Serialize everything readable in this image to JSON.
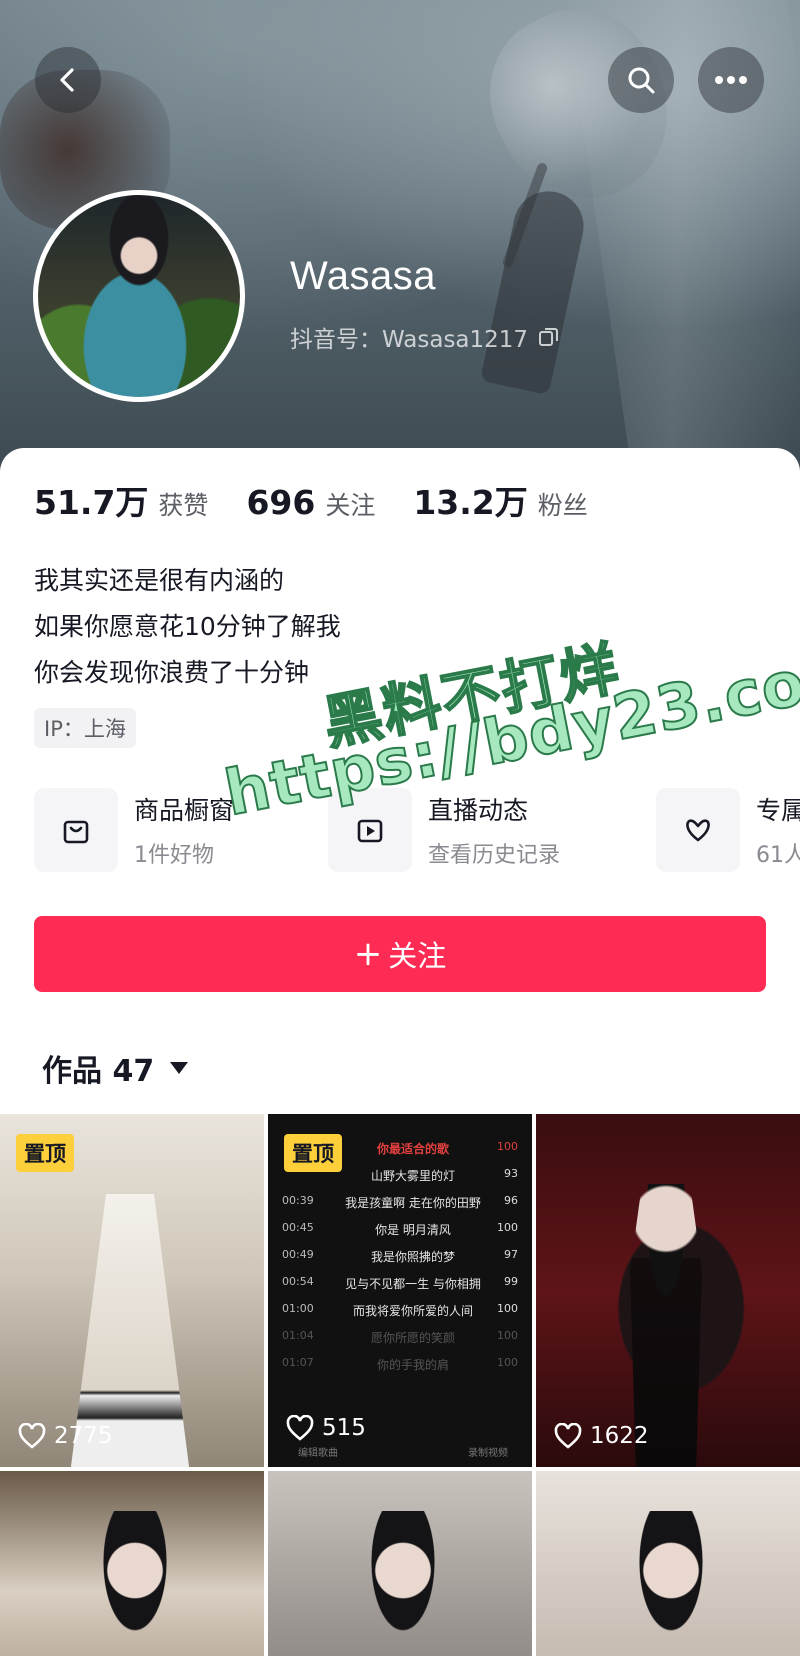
{
  "header": {
    "username": "Wasasa",
    "douyin_id": "抖音号：Wasasa1217",
    "icons": {
      "back": "back-arrow-icon",
      "search": "search-icon",
      "more": "more-dots-icon",
      "copy": "copy-icon"
    }
  },
  "stats": [
    {
      "num": "51.7万",
      "label": "获赞"
    },
    {
      "num": "696",
      "label": "关注"
    },
    {
      "num": "13.2万",
      "label": "粉丝"
    }
  ],
  "bio": {
    "line1": "我其实还是很有内涵的",
    "line2": "如果你愿意花10分钟了解我",
    "line3": "你会发现你浪费了十分钟"
  },
  "ip": "IP：上海",
  "features": [
    {
      "title": "商品橱窗",
      "sub": "1件好物",
      "icon": "bag-icon"
    },
    {
      "title": "直播动态",
      "sub": "查看历史记录",
      "icon": "live-icon"
    },
    {
      "title": "专属",
      "sub": "61人",
      "icon": "heart-v-icon"
    }
  ],
  "follow_button": {
    "plus": "+",
    "label": "关注"
  },
  "works_tab": {
    "label": "作品 47"
  },
  "watermark": {
    "line1": "黑料不打烊",
    "line2": "https://bdy23.co"
  },
  "videos": [
    {
      "pinned": "置顶",
      "likes": "2775"
    },
    {
      "pinned": "置顶",
      "likes": "515"
    },
    {
      "likes": "1622"
    }
  ],
  "lyric_card": {
    "header": {
      "title": "你最适合的歌",
      "score": "100"
    },
    "rows": [
      {
        "time": "",
        "text": "山野大雾里的灯",
        "score": "93"
      },
      {
        "time": "00:39",
        "text": "我是孩童啊 走在你的田野",
        "score": "96"
      },
      {
        "time": "00:45",
        "text": "你是 明月清风",
        "score": "100"
      },
      {
        "time": "00:49",
        "text": "我是你照拂的梦",
        "score": "97"
      },
      {
        "time": "00:54",
        "text": "见与不见都一生 与你相拥",
        "score": "99"
      },
      {
        "time": "01:00",
        "text": "而我将爱你所爱的人间",
        "score": "100"
      },
      {
        "time": "01:04",
        "text": "愿你所愿的笑颜",
        "score": "100"
      },
      {
        "time": "01:07",
        "text": "你的手我的肩",
        "score": "100"
      }
    ],
    "footer": {
      "left": "编辑歌曲",
      "right": "录制视频"
    }
  },
  "colors": {
    "accent": "#fe2c55",
    "pin": "#fccf3b",
    "text": "#161823"
  }
}
